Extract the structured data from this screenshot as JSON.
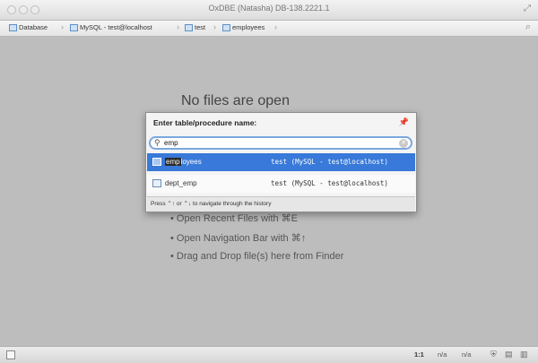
{
  "window": {
    "title": "OxDBE (Natasha) DB-138.2221.1"
  },
  "navbar": {
    "crumbs": [
      "Database",
      "MySQL - test@localhost",
      "test",
      "employees"
    ]
  },
  "editor": {
    "empty_title": "No files are open",
    "hints": [
      "• Open Recent Files with ⌘E",
      "• Open Navigation Bar with ⌘↑",
      "• Drag and Drop file(s) here from Finder"
    ]
  },
  "popup": {
    "title": "Enter table/procedure name:",
    "query": "emp",
    "results": [
      {
        "match": "emp",
        "rest": "loyees",
        "context": "test (MySQL - test@localhost)"
      },
      {
        "match": "",
        "rest": "dept_emp",
        "context": "test (MySQL - test@localhost)"
      }
    ],
    "footer": "Press ⌃↑ or ⌃↓ to navigate through the history"
  },
  "statusbar": {
    "position": "1:1",
    "fields": [
      "n/a",
      "n/a"
    ]
  }
}
